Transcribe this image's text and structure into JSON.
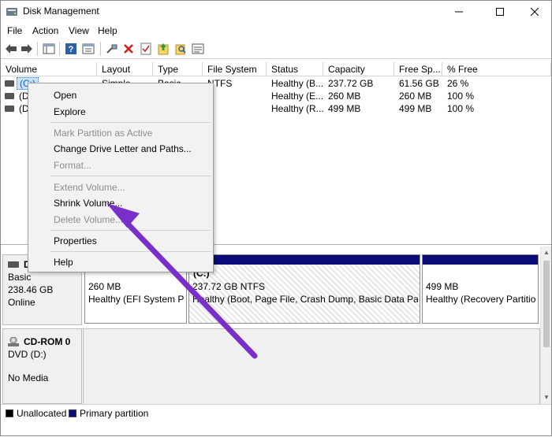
{
  "window": {
    "title": "Disk Management",
    "accent": "#0b0b7a"
  },
  "menu": [
    "File",
    "Action",
    "View",
    "Help"
  ],
  "toolbar": {
    "icons": [
      "back-icon",
      "forward-icon",
      "console-tree-icon",
      "help-icon",
      "properties-icon",
      "connect-icon",
      "delete-icon",
      "check-icon",
      "export-icon",
      "search-icon",
      "list-icon"
    ]
  },
  "volume_list": {
    "columns": [
      "Volume",
      "Layout",
      "Type",
      "File System",
      "Status",
      "Capacity",
      "Free Sp...",
      "% Free"
    ],
    "rows": [
      {
        "volume": "(C:)",
        "layout": "Simple",
        "type": "Basic",
        "fs": "NTFS",
        "status": "Healthy (B...",
        "capacity": "237.72 GB",
        "free": "61.56 GB",
        "pct": "26 %"
      },
      {
        "volume": "(Di",
        "layout": "",
        "type": "",
        "fs": "",
        "status": "Healthy (E...",
        "capacity": "260 MB",
        "free": "260 MB",
        "pct": "100 %"
      },
      {
        "volume": "(Di",
        "layout": "",
        "type": "",
        "fs": "",
        "status": "Healthy (R...",
        "capacity": "499 MB",
        "free": "499 MB",
        "pct": "100 %"
      }
    ]
  },
  "context_menu": {
    "items": [
      {
        "label": "Open",
        "enabled": true
      },
      {
        "label": "Explore",
        "enabled": true
      },
      {
        "label": "Mark Partition as Active",
        "enabled": false
      },
      {
        "label": "Change Drive Letter and Paths...",
        "enabled": true
      },
      {
        "label": "Format...",
        "enabled": false
      },
      {
        "label": "Extend Volume...",
        "enabled": false
      },
      {
        "label": "Shrink Volume...",
        "enabled": true
      },
      {
        "label": "Delete Volume...",
        "enabled": false
      },
      {
        "label": "Properties",
        "enabled": true
      },
      {
        "label": "Help",
        "enabled": true
      }
    ]
  },
  "disk0": {
    "name": "D",
    "type": "Basic",
    "size": "238.46 GB",
    "state": "Online",
    "partitions": [
      {
        "title": "",
        "size": "260 MB",
        "status": "Healthy (EFI System Par"
      },
      {
        "title": "(C:)",
        "size": "237.72 GB NTFS",
        "status": "Healthy (Boot, Page File, Crash Dump, Basic Data Partitio"
      },
      {
        "title": "",
        "size": "499 MB",
        "status": "Healthy (Recovery Partition"
      }
    ]
  },
  "cdrom": {
    "name": "CD-ROM 0",
    "type": "DVD (D:)",
    "media": "No Media"
  },
  "legend": [
    {
      "label": "Unallocated",
      "color": "#000000"
    },
    {
      "label": "Primary partition",
      "color": "#0b0b7a"
    }
  ],
  "annotation": {
    "color": "#7b2fc9"
  }
}
